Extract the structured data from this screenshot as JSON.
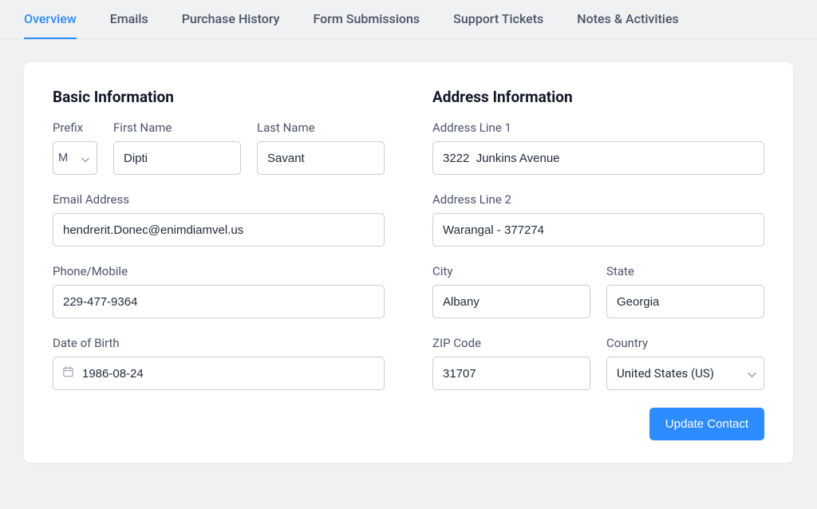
{
  "tabs": {
    "overview": "Overview",
    "emails": "Emails",
    "purchase_history": "Purchase History",
    "form_submissions": "Form Submissions",
    "support_tickets": "Support Tickets",
    "notes_activities": "Notes & Activities"
  },
  "sections": {
    "basic_title": "Basic Information",
    "address_title": "Address Information"
  },
  "labels": {
    "prefix": "Prefix",
    "first_name": "First Name",
    "last_name": "Last Name",
    "email": "Email Address",
    "phone": "Phone/Mobile",
    "dob": "Date of Birth",
    "address1": "Address Line 1",
    "address2": "Address Line 2",
    "city": "City",
    "state": "State",
    "zip": "ZIP Code",
    "country": "Country"
  },
  "values": {
    "prefix": "M",
    "first_name": "Dipti",
    "last_name": "Savant",
    "email": "hendrerit.Donec@enimdiamvel.us",
    "phone": "229-477-9364",
    "dob": "1986-08-24",
    "address1": "3222  Junkins Avenue",
    "address2": "Warangal - 377274",
    "city": "Albany",
    "state": "Georgia",
    "zip": "31707",
    "country": "United States (US)"
  },
  "buttons": {
    "update": "Update Contact"
  }
}
